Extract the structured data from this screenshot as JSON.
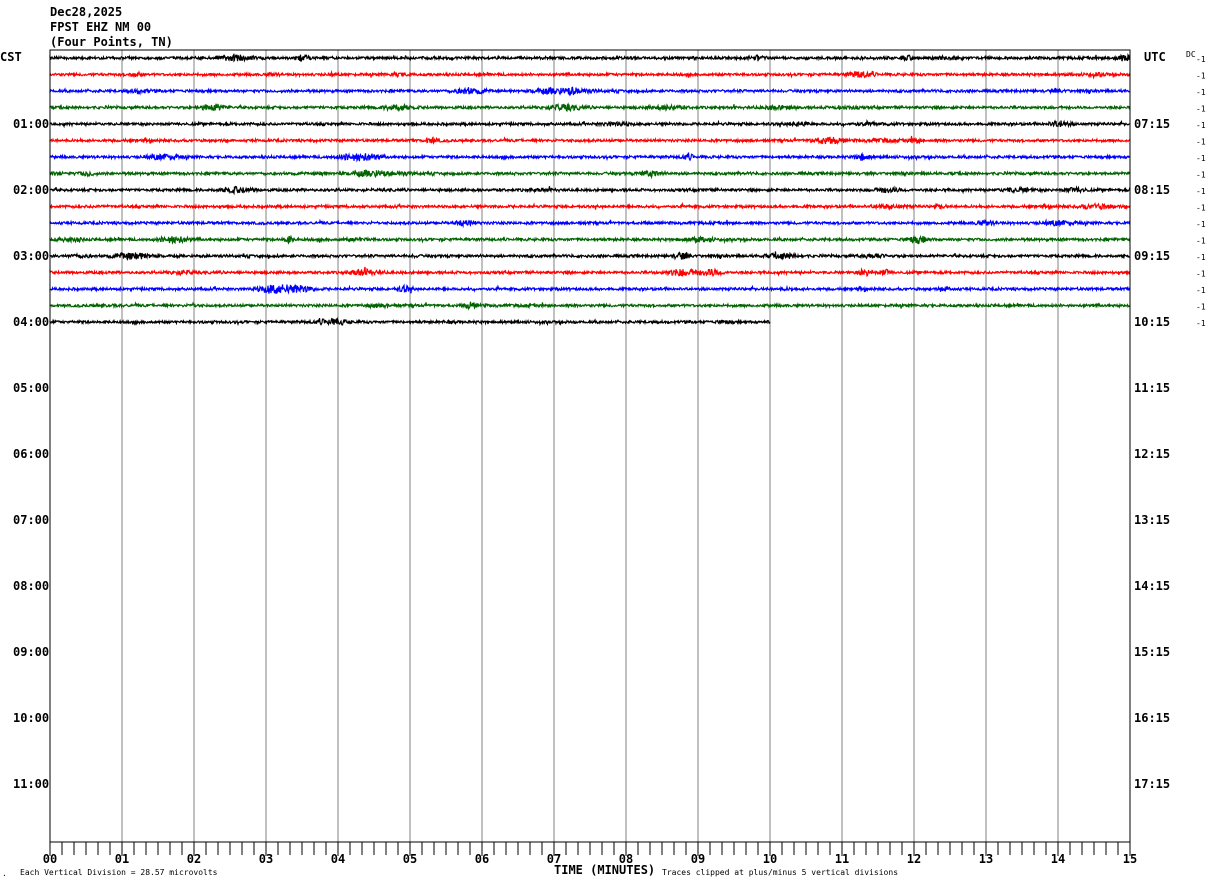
{
  "header": {
    "date": "Dec28,2025",
    "station": "FPST EHZ NM 00",
    "location": "(Four Points, TN)"
  },
  "chart_data": {
    "type": "line",
    "title": "FPST EHZ NM 00",
    "xlabel": "TIME (MINUTES)",
    "left_axis_label": "CST",
    "right_axis_label": "UTC",
    "dc_label": "DC",
    "x_ticks": [
      "00",
      "01",
      "02",
      "03",
      "04",
      "05",
      "06",
      "07",
      "08",
      "09",
      "10",
      "11",
      "12",
      "13",
      "14",
      "15"
    ],
    "xlim": [
      0,
      15
    ],
    "minor_tick_seconds": 10,
    "left_hour_labels": [
      "01:00",
      "02:00",
      "03:00",
      "04:00",
      "05:00",
      "06:00",
      "07:00",
      "08:00",
      "09:00",
      "10:00",
      "11:00"
    ],
    "right_hour_labels": [
      "07:15",
      "08:15",
      "09:15",
      "10:15",
      "11:15",
      "12:15",
      "13:15",
      "14:15",
      "15:15",
      "16:15",
      "17:15"
    ],
    "traces_per_hour": 4,
    "trace_count": 17,
    "trace_colors": [
      "#000000",
      "#ff0000",
      "#0000ff",
      "#006400"
    ],
    "last_trace_end_minute": 10,
    "dc_offsets": [
      "-1",
      "-1",
      "-1",
      "-1",
      "-1",
      "-1",
      "-1",
      "-1",
      "-1",
      "-1",
      "-1",
      "-1",
      "-1",
      "-1",
      "-1",
      "-1",
      "-1"
    ],
    "grid": true
  },
  "footer": {
    "scale_note": "Each Vertical Division =   28.57 microvolts",
    "clip_note": "Traces clipped at plus/minus 5 vertical divisions",
    "corner_mark": "A"
  }
}
